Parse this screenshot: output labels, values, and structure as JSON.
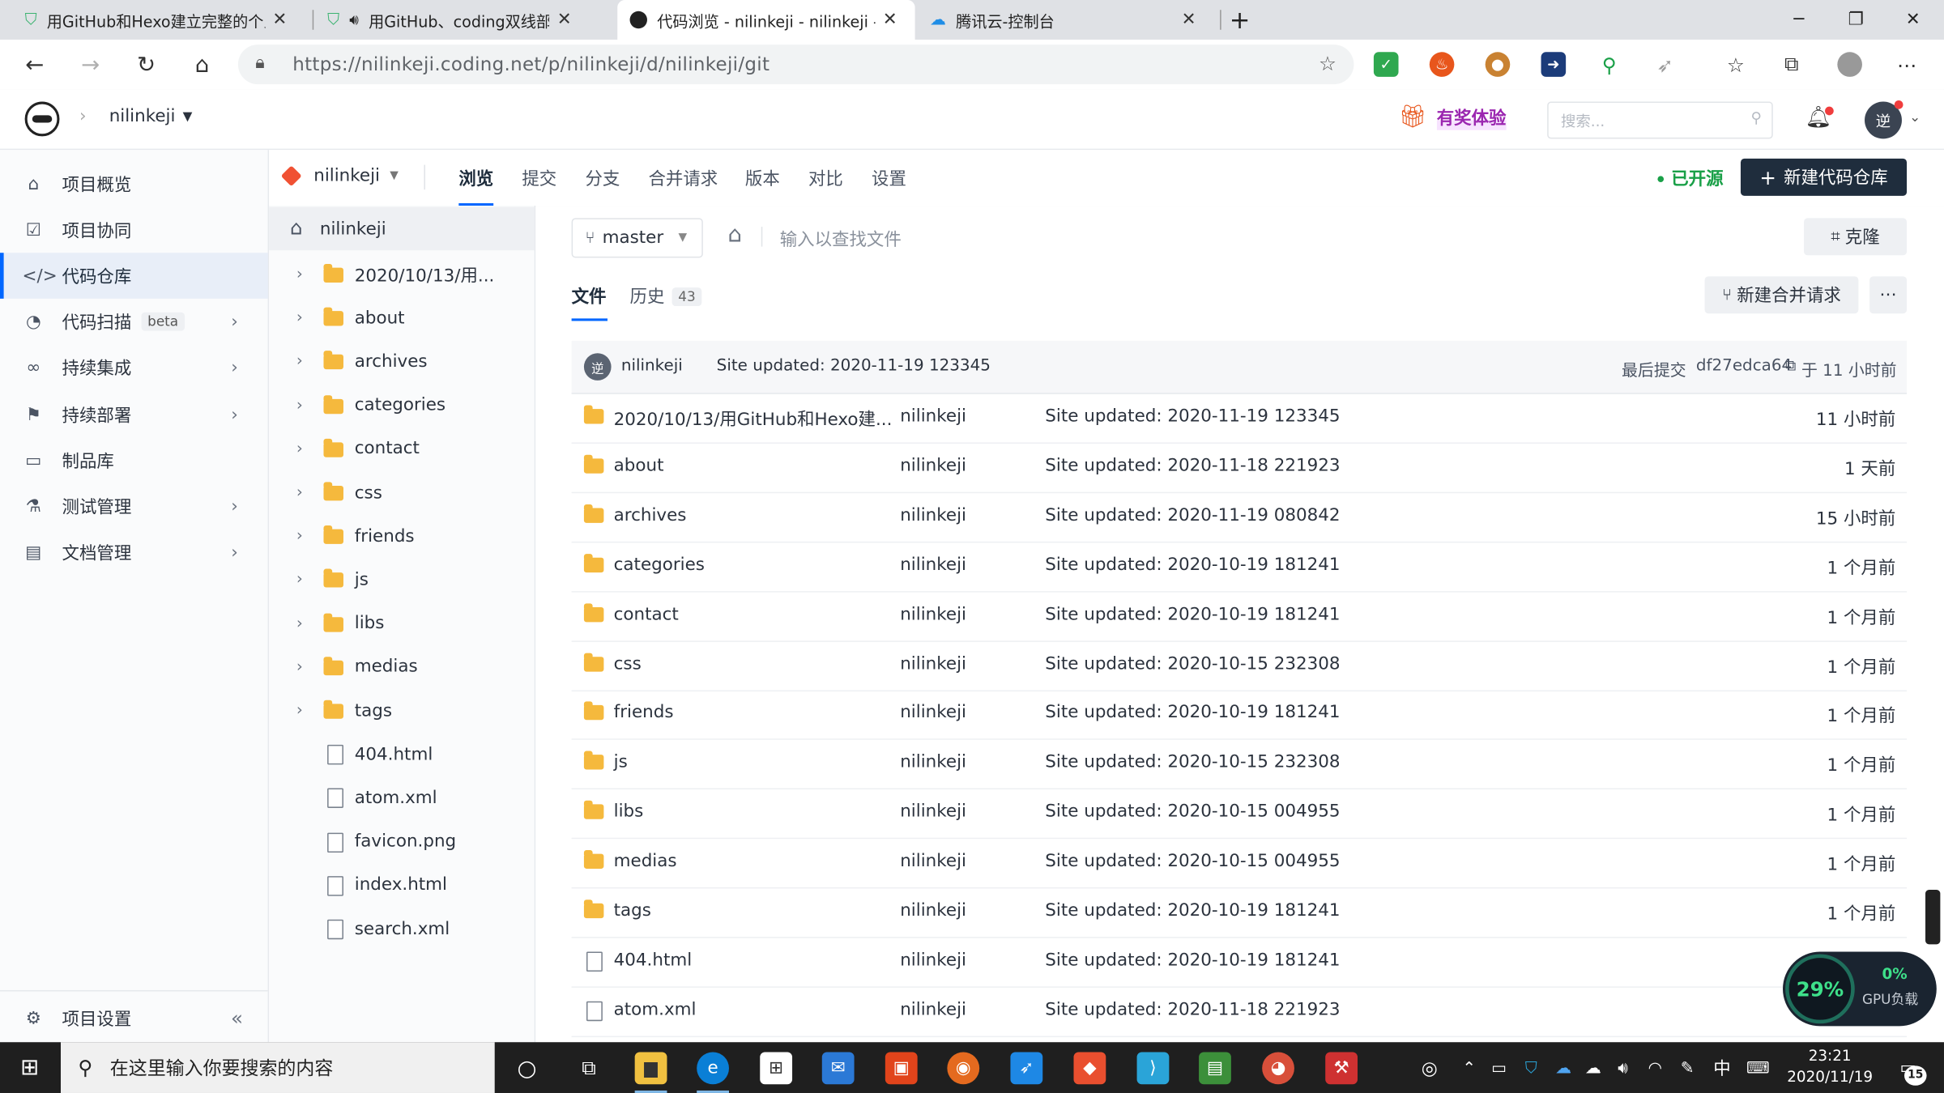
{
  "browser": {
    "tabs": [
      {
        "title": "用GitHub和Hexo建立完整的个人"
      },
      {
        "title": "用GitHub、coding双线部署"
      },
      {
        "title": "代码浏览 - nilinkeji - nilinkeji - 过"
      },
      {
        "title": "腾讯云-控制台"
      }
    ],
    "url": "https://nilinkeji.coding.net/p/nilinkeji/d/nilinkeji/git"
  },
  "header": {
    "team": "nilinkeji",
    "promo": "有奖体验",
    "search_placeholder": "搜索...",
    "avatar_text": "逆"
  },
  "sidebar": {
    "items": [
      {
        "label": "项目概览"
      },
      {
        "label": "项目协同"
      },
      {
        "label": "代码仓库"
      },
      {
        "label": "代码扫描",
        "badge": "beta"
      },
      {
        "label": "持续集成"
      },
      {
        "label": "持续部署"
      },
      {
        "label": "制品库"
      },
      {
        "label": "测试管理"
      },
      {
        "label": "文档管理"
      }
    ],
    "settings": "项目设置"
  },
  "repo_nav": {
    "repo": "nilinkeji",
    "tabs": [
      "浏览",
      "提交",
      "分支",
      "合并请求",
      "版本",
      "对比",
      "设置"
    ],
    "open_source": "已开源",
    "new_repo": "新建代码仓库"
  },
  "tree": {
    "root": "nilinkeji",
    "items": [
      {
        "name": "2020/10/13/用...",
        "type": "folder"
      },
      {
        "name": "about",
        "type": "folder"
      },
      {
        "name": "archives",
        "type": "folder"
      },
      {
        "name": "categories",
        "type": "folder"
      },
      {
        "name": "contact",
        "type": "folder"
      },
      {
        "name": "css",
        "type": "folder"
      },
      {
        "name": "friends",
        "type": "folder"
      },
      {
        "name": "js",
        "type": "folder"
      },
      {
        "name": "libs",
        "type": "folder"
      },
      {
        "name": "medias",
        "type": "folder"
      },
      {
        "name": "tags",
        "type": "folder"
      },
      {
        "name": "404.html",
        "type": "file"
      },
      {
        "name": "atom.xml",
        "type": "file"
      },
      {
        "name": "favicon.png",
        "type": "file"
      },
      {
        "name": "index.html",
        "type": "file"
      },
      {
        "name": "search.xml",
        "type": "file"
      }
    ]
  },
  "main": {
    "branch": "master",
    "search_placeholder": "输入以查找文件",
    "clone": "克隆",
    "tab_files": "文件",
    "tab_history": "历史",
    "history_count": "43",
    "new_mr": "新建合并请求",
    "commit": {
      "author": "nilinkeji",
      "message": "Site updated: 2020-11-19 123345",
      "last_label": "最后提交",
      "hash": "df27edca64",
      "time": "于 11 小时前"
    },
    "files": [
      {
        "name": "2020/10/13/用GitHub和Hexo建...",
        "author": "nilinkeji",
        "message": "Site updated: 2020-11-19 123345",
        "time": "11 小时前",
        "type": "folder"
      },
      {
        "name": "about",
        "author": "nilinkeji",
        "message": "Site updated: 2020-11-18 221923",
        "time": "1 天前",
        "type": "folder"
      },
      {
        "name": "archives",
        "author": "nilinkeji",
        "message": "Site updated: 2020-11-19 080842",
        "time": "15 小时前",
        "type": "folder"
      },
      {
        "name": "categories",
        "author": "nilinkeji",
        "message": "Site updated: 2020-10-19 181241",
        "time": "1 个月前",
        "type": "folder"
      },
      {
        "name": "contact",
        "author": "nilinkeji",
        "message": "Site updated: 2020-10-19 181241",
        "time": "1 个月前",
        "type": "folder"
      },
      {
        "name": "css",
        "author": "nilinkeji",
        "message": "Site updated: 2020-10-15 232308",
        "time": "1 个月前",
        "type": "folder"
      },
      {
        "name": "friends",
        "author": "nilinkeji",
        "message": "Site updated: 2020-10-19 181241",
        "time": "1 个月前",
        "type": "folder"
      },
      {
        "name": "js",
        "author": "nilinkeji",
        "message": "Site updated: 2020-10-15 232308",
        "time": "1 个月前",
        "type": "folder"
      },
      {
        "name": "libs",
        "author": "nilinkeji",
        "message": "Site updated: 2020-10-15 004955",
        "time": "1 个月前",
        "type": "folder"
      },
      {
        "name": "medias",
        "author": "nilinkeji",
        "message": "Site updated: 2020-10-15 004955",
        "time": "1 个月前",
        "type": "folder"
      },
      {
        "name": "tags",
        "author": "nilinkeji",
        "message": "Site updated: 2020-10-19 181241",
        "time": "1 个月前",
        "type": "folder"
      },
      {
        "name": "404.html",
        "author": "nilinkeji",
        "message": "Site updated: 2020-10-19 181241",
        "time": "1 个月前",
        "type": "file"
      },
      {
        "name": "atom.xml",
        "author": "nilinkeji",
        "message": "Site updated: 2020-11-18 221923",
        "time": "",
        "type": "file"
      }
    ]
  },
  "gpu_widget": {
    "percent": "29%",
    "gpu_value": "0%",
    "gpu_label": "GPU负载"
  },
  "taskbar": {
    "search_placeholder": "在这里输入你要搜索的内容",
    "time": "23:21",
    "date": "2020/11/19",
    "ime": "中",
    "notifications": "15"
  },
  "colors": {
    "accent": "#0066ff",
    "open_source": "#1aa048",
    "new_repo_bg": "#1f2d3d",
    "folder": "#f5b93d"
  }
}
